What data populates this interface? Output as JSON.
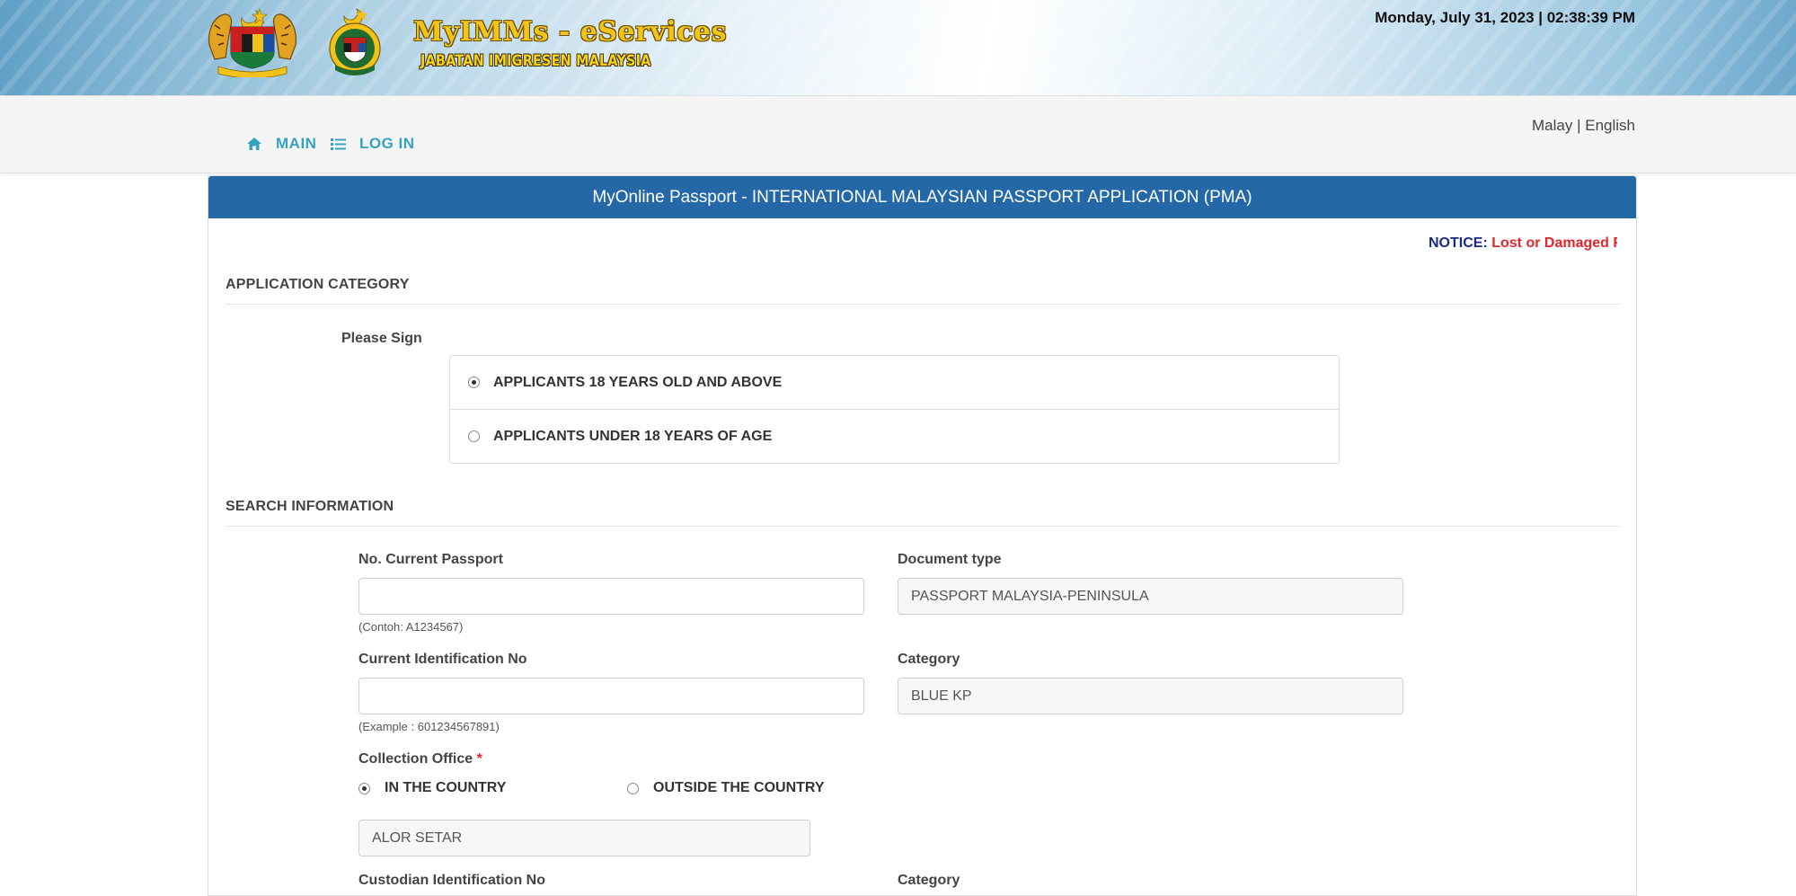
{
  "header": {
    "brand_title": "MyIMMs - eServices",
    "brand_subtitle": "JABATAN IMIGRESEN MALAYSIA",
    "datetime": "Monday, July 31, 2023  | 02:38:39 PM"
  },
  "nav": {
    "main_label": "MAIN",
    "login_label": "LOG IN",
    "lang_malay": "Malay",
    "lang_sep": " | ",
    "lang_english": "English"
  },
  "panel": {
    "title": "MyOnline Passport - INTERNATIONAL MALAYSIAN PASSPORT APPLICATION (PMA)",
    "notice_label": "NOTICE:",
    "notice_text": " Lost or Damaged F"
  },
  "application_category": {
    "section_title": "APPLICATION CATEGORY",
    "prompt": "Please Sign",
    "options": [
      {
        "label": "APPLICANTS 18 YEARS OLD AND ABOVE",
        "selected": true
      },
      {
        "label": "APPLICANTS UNDER 18 YEARS OF AGE",
        "selected": false
      }
    ]
  },
  "search_information": {
    "section_title": "SEARCH INFORMATION",
    "current_passport_label": "No. Current Passport",
    "current_passport_value": "",
    "current_passport_hint": "(Contoh: A1234567)",
    "document_type_label": "Document type",
    "document_type_value": "PASSPORT MALAYSIA-PENINSULA",
    "identification_label": "Current Identification No",
    "identification_value": "",
    "identification_hint": "(Example : 601234567891)",
    "category_label": "Category",
    "category_value": "BLUE KP",
    "collection_office_label": "Collection Office",
    "required_mark": "*",
    "collection_options": [
      {
        "label": "IN THE COUNTRY",
        "selected": true
      },
      {
        "label": "OUTSIDE THE COUNTRY",
        "selected": false
      }
    ],
    "collection_office_value": "ALOR SETAR",
    "custodian_label": "Custodian Identification No",
    "custodian_category_label": "Category"
  },
  "colors": {
    "panel_header": "#2468a8",
    "nav_link": "#35a3bf",
    "notice_label": "#1c2a87",
    "notice_text": "#e1262e"
  }
}
